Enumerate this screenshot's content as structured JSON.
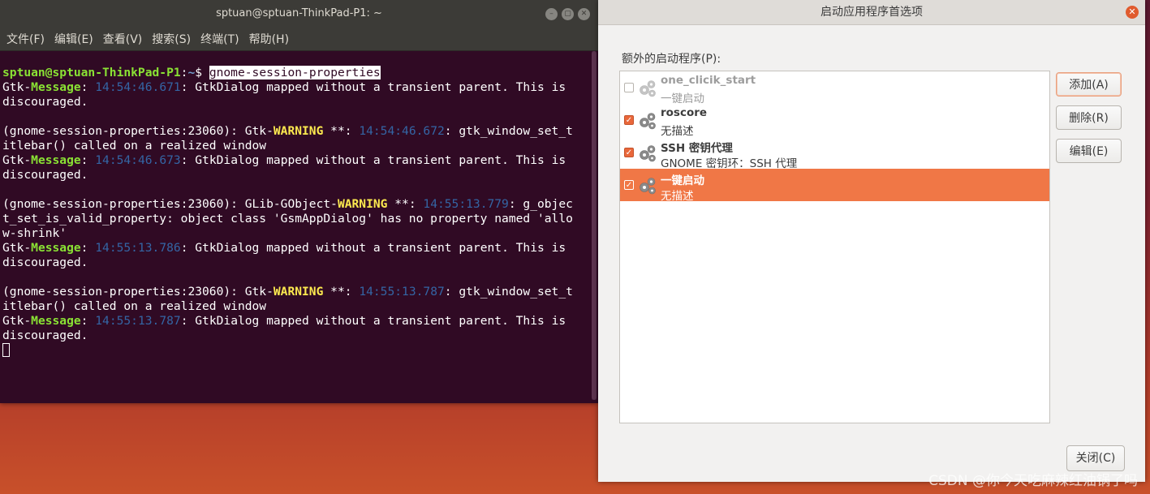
{
  "terminal": {
    "title": "sptuan@sptuan-ThinkPad-P1: ~",
    "menu": [
      "文件(F)",
      "编辑(E)",
      "查看(V)",
      "搜索(S)",
      "终端(T)",
      "帮助(H)"
    ],
    "prompt_user": "sptuan@sptuan-ThinkPad-P1",
    "prompt_sep": ":",
    "prompt_path": "~",
    "prompt_sign": "$ ",
    "command": "gnome-session-properties",
    "lines": [
      [
        {
          "t": "Gtk-",
          "c": ""
        },
        {
          "t": "Message",
          "c": "gtk-msg"
        },
        {
          "t": ": ",
          "c": ""
        },
        {
          "t": "14:54:46.671",
          "c": "ts"
        },
        {
          "t": ": GtkDialog mapped without a transient parent. This is",
          "c": ""
        }
      ],
      [
        {
          "t": "discouraged.",
          "c": ""
        }
      ],
      [
        {
          "t": "",
          "c": ""
        }
      ],
      [
        {
          "t": "(gnome-session-properties:23060): Gtk-",
          "c": ""
        },
        {
          "t": "WARNING",
          "c": "gtk-warn"
        },
        {
          "t": " **: ",
          "c": ""
        },
        {
          "t": "14:54:46.672",
          "c": "ts"
        },
        {
          "t": ": gtk_window_set_t",
          "c": ""
        }
      ],
      [
        {
          "t": "itlebar() called on a realized window",
          "c": ""
        }
      ],
      [
        {
          "t": "Gtk-",
          "c": ""
        },
        {
          "t": "Message",
          "c": "gtk-msg"
        },
        {
          "t": ": ",
          "c": ""
        },
        {
          "t": "14:54:46.673",
          "c": "ts"
        },
        {
          "t": ": GtkDialog mapped without a transient parent. This is",
          "c": ""
        }
      ],
      [
        {
          "t": "discouraged.",
          "c": ""
        }
      ],
      [
        {
          "t": "",
          "c": ""
        }
      ],
      [
        {
          "t": "(gnome-session-properties:23060): GLib-GObject-",
          "c": ""
        },
        {
          "t": "WARNING",
          "c": "gtk-warn"
        },
        {
          "t": " **: ",
          "c": ""
        },
        {
          "t": "14:55:13.779",
          "c": "ts"
        },
        {
          "t": ": g_objec",
          "c": ""
        }
      ],
      [
        {
          "t": "t_set_is_valid_property: object class 'GsmAppDialog' has no property named 'allo",
          "c": ""
        }
      ],
      [
        {
          "t": "w-shrink'",
          "c": ""
        }
      ],
      [
        {
          "t": "Gtk-",
          "c": ""
        },
        {
          "t": "Message",
          "c": "gtk-msg"
        },
        {
          "t": ": ",
          "c": ""
        },
        {
          "t": "14:55:13.786",
          "c": "ts"
        },
        {
          "t": ": GtkDialog mapped without a transient parent. This is",
          "c": ""
        }
      ],
      [
        {
          "t": "discouraged.",
          "c": ""
        }
      ],
      [
        {
          "t": "",
          "c": ""
        }
      ],
      [
        {
          "t": "(gnome-session-properties:23060): Gtk-",
          "c": ""
        },
        {
          "t": "WARNING",
          "c": "gtk-warn"
        },
        {
          "t": " **: ",
          "c": ""
        },
        {
          "t": "14:55:13.787",
          "c": "ts"
        },
        {
          "t": ": gtk_window_set_t",
          "c": ""
        }
      ],
      [
        {
          "t": "itlebar() called on a realized window",
          "c": ""
        }
      ],
      [
        {
          "t": "Gtk-",
          "c": ""
        },
        {
          "t": "Message",
          "c": "gtk-msg"
        },
        {
          "t": ": ",
          "c": ""
        },
        {
          "t": "14:55:13.787",
          "c": "ts"
        },
        {
          "t": ": GtkDialog mapped without a transient parent. This is",
          "c": ""
        }
      ],
      [
        {
          "t": "discouraged.",
          "c": ""
        }
      ]
    ]
  },
  "dialog": {
    "title": "启动应用程序首选项",
    "list_label": "额外的启动程序(P):",
    "items": [
      {
        "name": "one_clicik_start",
        "desc": "一键启动",
        "checked": false,
        "disabled": true,
        "selected": false
      },
      {
        "name": "roscore",
        "desc": "无描述",
        "checked": true,
        "disabled": false,
        "selected": false
      },
      {
        "name": "SSH 密钥代理",
        "desc": "GNOME 密钥环：SSH 代理",
        "checked": true,
        "disabled": false,
        "selected": false
      },
      {
        "name": "一键启动",
        "desc": "无描述",
        "checked": true,
        "disabled": false,
        "selected": true
      }
    ],
    "add_label": "添加(A)",
    "remove_label": "删除(R)",
    "edit_label": "编辑(E)",
    "close_label": "关闭(C)",
    "icon": "gear-icon",
    "accent_color": "#f07746"
  },
  "watermark": "CSDN @你今天吃麻辣红油锅了吗"
}
